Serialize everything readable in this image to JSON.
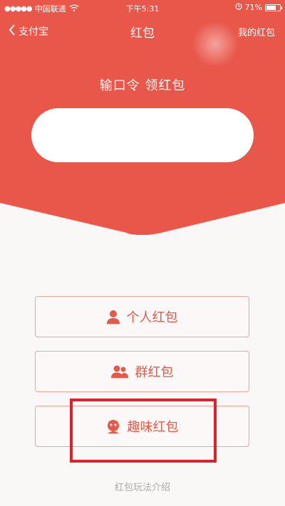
{
  "status_bar": {
    "signal": "●●●●●",
    "carrier": "中国联通",
    "wifi_icon": "wifi-icon",
    "time": "下午5:31",
    "battery_percent": "71%",
    "battery_level": 0.71
  },
  "nav": {
    "back_label": "支付宝",
    "title": "红包",
    "right_label": "我的红包"
  },
  "hero": {
    "prompt": "输口令 领红包",
    "input_value": "",
    "background_color": "#e9574b"
  },
  "options": [
    {
      "label": "个人红包",
      "icon": "person-icon"
    },
    {
      "label": "群红包",
      "icon": "group-icon"
    },
    {
      "label": "趣味红包",
      "icon": "fun-face-icon"
    }
  ],
  "footer": {
    "link": "红包玩法介绍"
  },
  "colors": {
    "accent": "#e9574b",
    "highlight": "#e0202a",
    "button_border": "#e3a99d"
  }
}
